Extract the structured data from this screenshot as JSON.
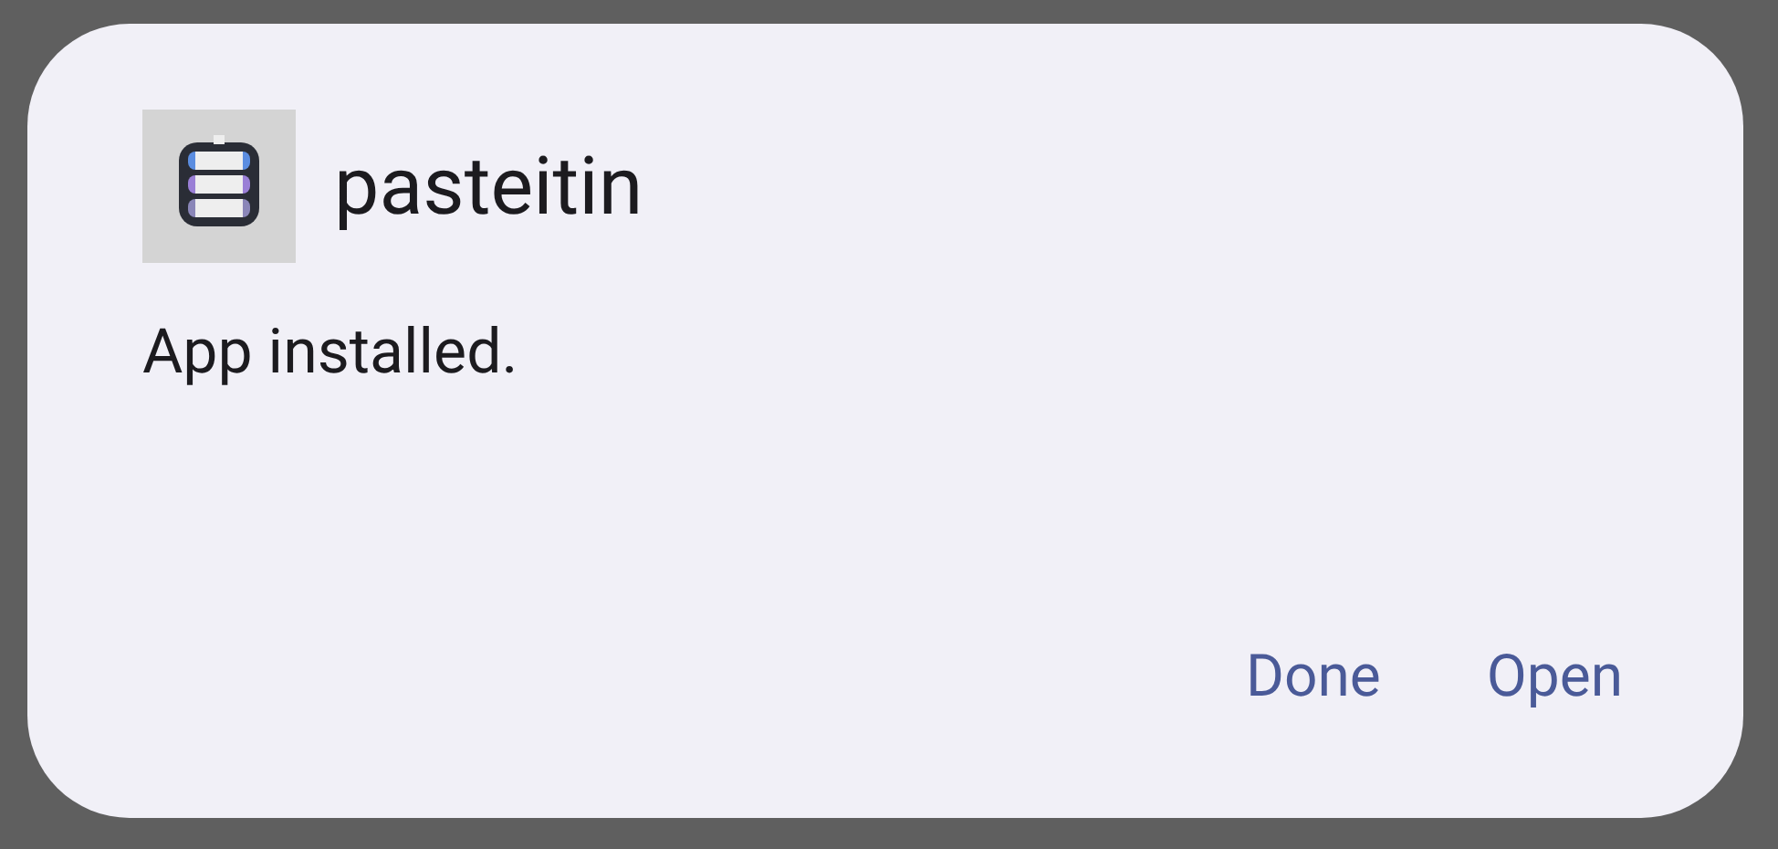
{
  "dialog": {
    "app_name": "pasteitin",
    "message": "App installed.",
    "buttons": [
      "Done",
      "Open"
    ]
  }
}
